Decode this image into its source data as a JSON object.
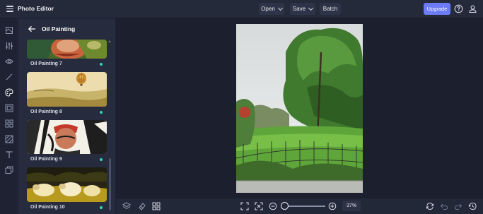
{
  "app": {
    "title": "Photo Editor"
  },
  "toolbar": {
    "open_label": "Open",
    "save_label": "Save",
    "batch_label": "Batch",
    "upgrade_label": "Upgrade",
    "accent": "#6b7cf6"
  },
  "rail": {
    "icons": [
      "crop-icon",
      "adjust-sliders-icon",
      "eye-icon",
      "magic-wand-icon",
      "palette-icon",
      "frame-icon",
      "shapes-icon",
      "overlay-icon",
      "text-icon",
      "stickers-icon"
    ],
    "active": "palette-icon"
  },
  "panel": {
    "title": "Oil Painting",
    "items": [
      {
        "label": "Oil Painting 7"
      },
      {
        "label": "Oil Painting 8"
      },
      {
        "label": "Oil Painting 9"
      },
      {
        "label": "Oil Painting 10"
      }
    ],
    "dot_color": "#39d1b4"
  },
  "bottombar": {
    "zoom": "37%"
  }
}
